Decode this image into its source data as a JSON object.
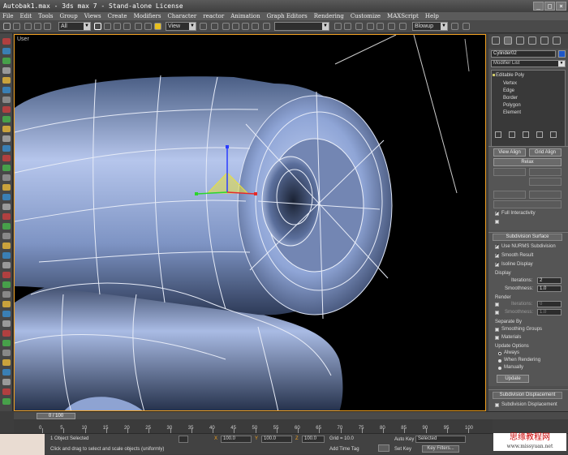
{
  "window": {
    "title": "Autobak1.max - 3ds max 7 - Stand-alone License"
  },
  "menu": [
    "File",
    "Edit",
    "Tools",
    "Group",
    "Views",
    "Create",
    "Modifiers",
    "Character",
    "reactor",
    "Animation",
    "Graph Editors",
    "Rendering",
    "Customize",
    "MAXScript",
    "Help"
  ],
  "toolbar": {
    "selection_filter": "All",
    "ref_coord": "View",
    "named_selection": "",
    "render_type": "Blowup"
  },
  "viewport": {
    "label": "User"
  },
  "panel": {
    "object_name": "Cylinder02",
    "object_color": "#1f57c9",
    "modifier_list": "Modifier List",
    "stack_root": "Editable Poly",
    "stack_subs": [
      "Vertex",
      "Edge",
      "Border",
      "Polygon",
      "Element"
    ],
    "buttons": {
      "view_align": "View Align",
      "grid_align": "Grid Align",
      "relax": "Relax"
    },
    "full_interactivity": "Full Interactivity",
    "subdivision_surface": {
      "title": "Subdivision Surface",
      "use_nurms": "Use NURMS Subdivision",
      "smooth_result": "Smooth Result",
      "isoline_display": "Isoline Display",
      "display_label": "Display",
      "iterations_label": "Iterations:",
      "iterations_value": "2",
      "smoothness_label": "Smoothness:",
      "smoothness_value": "1.0",
      "render_label": "Render",
      "render_iterations_value": "0",
      "render_smoothness_value": "1.0",
      "separate_by": "Separate By",
      "smoothing_groups": "Smoothing Groups",
      "materials": "Materials",
      "update_options": "Update Options",
      "always": "Always",
      "when_rendering": "When Rendering",
      "manually": "Manually",
      "update": "Update"
    },
    "subdivision_displacement": {
      "title": "Subdivision Displacement",
      "checkbox": "Subdivision Displacement"
    }
  },
  "timeline": {
    "slider": "0 / 100",
    "ticks": [
      "0",
      "5",
      "10",
      "15",
      "20",
      "25",
      "30",
      "35",
      "40",
      "45",
      "50",
      "55",
      "60",
      "65",
      "70",
      "75",
      "80",
      "85",
      "90",
      "95",
      "100"
    ]
  },
  "status": {
    "selected": "1 Object Selected",
    "prompt": "Click and drag to select and scale objects (uniformly)",
    "x_label": "X",
    "x_value": "100.0",
    "y_label": "Y",
    "y_value": "100.0",
    "z_label": "Z",
    "z_value": "100.0",
    "grid": "Grid = 10.0",
    "add_time_tag": "Add Time Tag",
    "auto_key": "Auto Key",
    "set_key": "Set Key",
    "selected_dropdown": "Selected",
    "key_filters": "Key Filters..."
  },
  "watermark": {
    "line1": "思缘教程网",
    "line2": "www.missyuan.net"
  }
}
